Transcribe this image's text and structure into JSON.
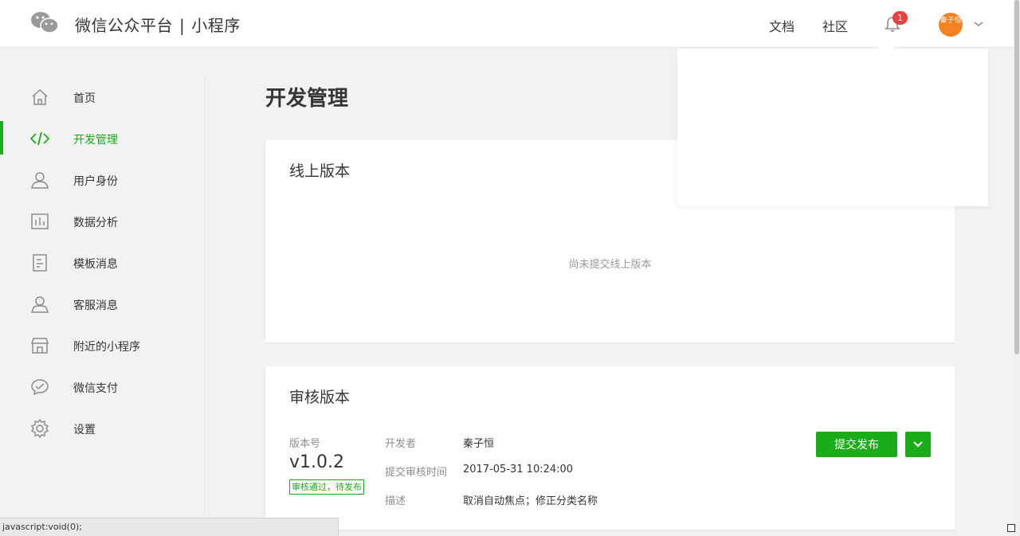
{
  "header": {
    "brand": "微信公众平台",
    "separator": "|",
    "product": "小程序",
    "links": [
      "文档",
      "社区"
    ],
    "notification_count": "1",
    "avatar_text": "秦子恒"
  },
  "sidebar": {
    "items": [
      {
        "label": "首页",
        "icon": "home-icon"
      },
      {
        "label": "开发管理",
        "icon": "code-icon",
        "active": true
      },
      {
        "label": "用户身份",
        "icon": "user-icon"
      },
      {
        "label": "数据分析",
        "icon": "chart-icon"
      },
      {
        "label": "模板消息",
        "icon": "document-icon"
      },
      {
        "label": "客服消息",
        "icon": "support-icon"
      },
      {
        "label": "附近的小程序",
        "icon": "store-icon"
      },
      {
        "label": "微信支付",
        "icon": "pay-icon"
      },
      {
        "label": "设置",
        "icon": "gear-icon"
      }
    ]
  },
  "main": {
    "page_title": "开发管理",
    "online_card": {
      "title": "线上版本",
      "empty_text": "尚未提交线上版本"
    },
    "review_card": {
      "title": "审核版本",
      "version_label": "版本号",
      "version": "v1.0.2",
      "status": "审核通过，待发布",
      "developer_label": "开发者",
      "developer": "秦子恒",
      "submit_time_label": "提交审核时间",
      "submit_time": "2017-05-31 10:24:00",
      "desc_label": "描述",
      "desc": "取消自动焦点；修正分类名称",
      "publish_button": "提交发布"
    }
  },
  "statusbar": {
    "text": "javascript:void(0);"
  },
  "colors": {
    "accent": "#1aad19",
    "badge": "#e64340",
    "avatar": "#f58220"
  }
}
